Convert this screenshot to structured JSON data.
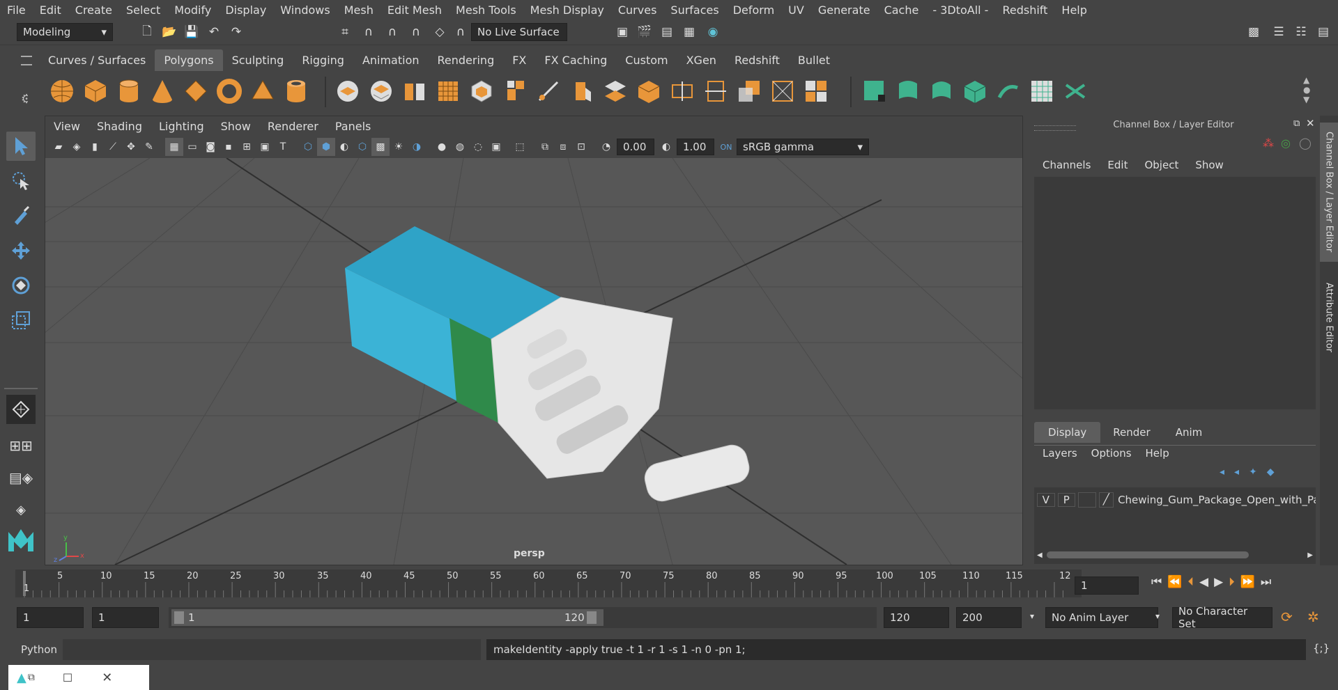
{
  "menu": [
    "File",
    "Edit",
    "Create",
    "Select",
    "Modify",
    "Display",
    "Windows",
    "Mesh",
    "Edit Mesh",
    "Mesh Tools",
    "Mesh Display",
    "Curves",
    "Surfaces",
    "Deform",
    "UV",
    "Generate",
    "Cache",
    "- 3DtoAll -",
    "Redshift",
    "Help"
  ],
  "status": {
    "workspace": "Modeling",
    "live_surface": "No Live Surface"
  },
  "shelf_tabs": [
    "Curves / Surfaces",
    "Polygons",
    "Sculpting",
    "Rigging",
    "Animation",
    "Rendering",
    "FX",
    "FX Caching",
    "Custom",
    "XGen",
    "Redshift",
    "Bullet"
  ],
  "shelf_active": "Polygons",
  "viewport": {
    "menu": [
      "View",
      "Shading",
      "Lighting",
      "Show",
      "Renderer",
      "Panels"
    ],
    "exposure": "0.00",
    "gamma": "1.00",
    "colorspace": "sRGB gamma",
    "camera": "persp",
    "axis": {
      "x": "x",
      "y": "y",
      "z": "z"
    }
  },
  "channel_box": {
    "title": "Channel Box / Layer Editor",
    "menu": [
      "Channels",
      "Edit",
      "Object",
      "Show"
    ],
    "layer_tabs": [
      "Display",
      "Render",
      "Anim"
    ],
    "layer_menu": [
      "Layers",
      "Options",
      "Help"
    ],
    "layer": {
      "v": "V",
      "p": "P",
      "name": "Chewing_Gum_Package_Open_with_Pa"
    }
  },
  "side_tabs": [
    "Channel Box / Layer Editor",
    "Attribute Editor"
  ],
  "timeline": {
    "ticks": [
      "1",
      "5",
      "10",
      "15",
      "20",
      "25",
      "30",
      "35",
      "40",
      "45",
      "50",
      "55",
      "60",
      "65",
      "70",
      "75",
      "80",
      "85",
      "90",
      "95",
      "100",
      "105",
      "110",
      "115",
      "12"
    ],
    "current_frame": "1"
  },
  "range": {
    "start": "1",
    "playback_start": "1",
    "slider_start": "1",
    "slider_end": "120",
    "playback_end": "120",
    "end": "200",
    "anim_layer": "No Anim Layer",
    "character_set": "No Character Set"
  },
  "command": {
    "language": "Python",
    "output": "makeIdentity -apply true -t 1 -r 1 -s 1 -n 0 -pn 1;"
  },
  "colors": {
    "accent": "#5fa0d6",
    "shelf_orange": "#e8963a",
    "shelf_green": "#3fb38e",
    "bg": "#444444"
  }
}
